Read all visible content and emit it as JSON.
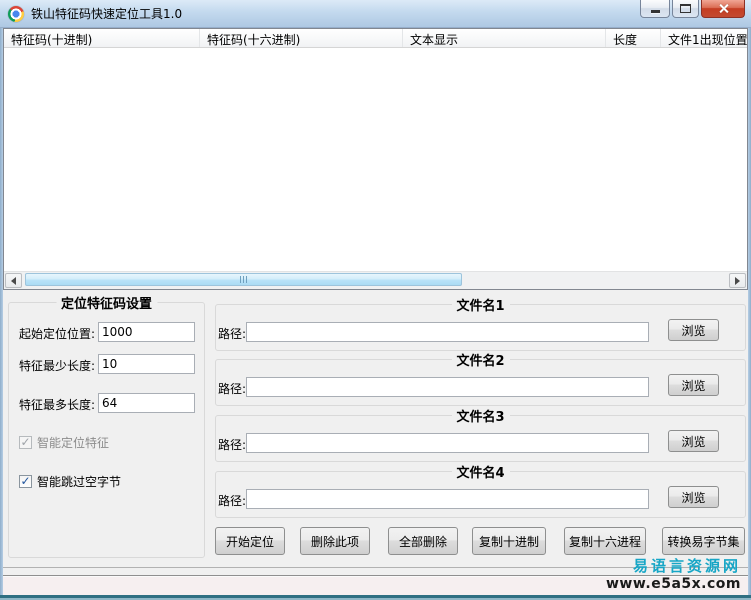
{
  "window": {
    "title": "铁山特征码快速定位工具1.0",
    "app_icon": "chrome-logo-icon"
  },
  "list": {
    "columns": [
      "特征码(十进制)",
      "特征码(十六进制)",
      "文本显示",
      "长度",
      "文件1出现位置"
    ],
    "rows": []
  },
  "settings": {
    "title": "定位特征码设置",
    "fields": [
      {
        "label": "起始定位位置:",
        "value": "1000"
      },
      {
        "label": "特征最少长度:",
        "value": "10"
      },
      {
        "label": "特征最多长度:",
        "value": "64"
      }
    ],
    "checkboxes": [
      {
        "label": "智能定位特征",
        "checked": true,
        "disabled": true
      },
      {
        "label": "智能跳过空字节",
        "checked": true,
        "disabled": false
      }
    ]
  },
  "file_groups": [
    {
      "title": "文件名1",
      "path_label": "路径:",
      "path_value": "",
      "browse_label": "浏览"
    },
    {
      "title": "文件名2",
      "path_label": "路径:",
      "path_value": "",
      "browse_label": "浏览"
    },
    {
      "title": "文件名3",
      "path_label": "路径:",
      "path_value": "",
      "browse_label": "浏览"
    },
    {
      "title": "文件名4",
      "path_label": "路径:",
      "path_value": "",
      "browse_label": "浏览"
    }
  ],
  "actions": [
    "开始定位",
    "删除此项",
    "全部删除",
    "复制十进制",
    "复制十六进程",
    "转换易字节集"
  ],
  "watermark": {
    "site_name": "易语言资源网",
    "site_url": "www.e5a5x.com"
  },
  "icons": {
    "check": "✓"
  },
  "colors": {
    "titlebar": "#C3D9EE",
    "close_button": "#C53D22",
    "watermark_teal": "#17A6C6",
    "panel_bg": "#F0F0F0",
    "scroll_thumb": "#B9E3F8"
  }
}
